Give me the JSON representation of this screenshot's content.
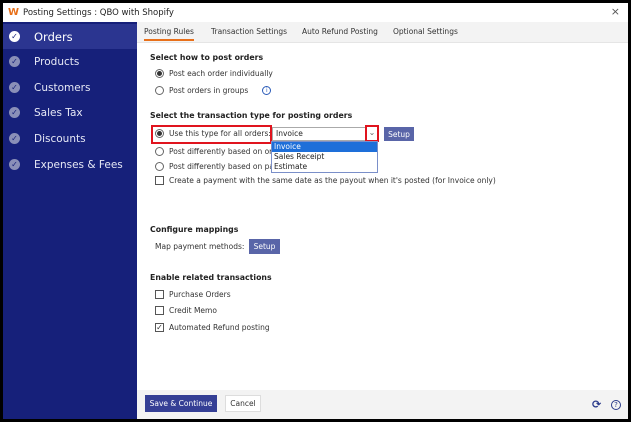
{
  "window": {
    "title": "Posting Settings : QBO with Shopify",
    "close": "×"
  },
  "sidebar": {
    "items": [
      {
        "label": "Orders"
      },
      {
        "label": "Products"
      },
      {
        "label": "Customers"
      },
      {
        "label": "Sales Tax"
      },
      {
        "label": "Discounts"
      },
      {
        "label": "Expenses & Fees"
      }
    ]
  },
  "tabs": [
    {
      "label": "Posting Rules"
    },
    {
      "label": "Transaction Settings"
    },
    {
      "label": "Auto Refund Posting"
    },
    {
      "label": "Optional Settings"
    }
  ],
  "post_orders": {
    "heading": "Select how to post orders",
    "options": [
      "Post each order individually",
      "Post orders in groups"
    ]
  },
  "transaction_type": {
    "heading": "Select the transaction type for posting orders",
    "use_type_label": "Use this type for all orders:",
    "selected": "Invoice",
    "options": [
      "Invoice",
      "Sales Receipt",
      "Estimate"
    ],
    "setup": "Setup",
    "option2": "Post differently based on order",
    "option3": "Post differently based on payment",
    "payment_checkbox": "Create a payment with the same date as the payout when it's posted (for Invoice only)"
  },
  "mappings": {
    "heading": "Configure mappings",
    "label": "Map payment methods:",
    "setup": "Setup"
  },
  "related": {
    "heading": "Enable related transactions",
    "items": [
      {
        "label": "Purchase Orders",
        "checked": false
      },
      {
        "label": "Credit Memo",
        "checked": false
      },
      {
        "label": "Automated Refund posting",
        "checked": true
      }
    ]
  },
  "footer": {
    "save": "Save & Continue",
    "cancel": "Cancel"
  }
}
